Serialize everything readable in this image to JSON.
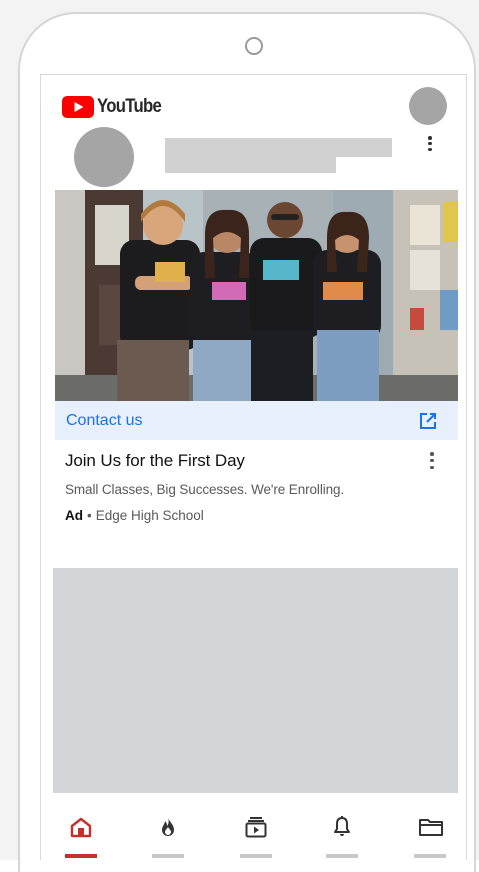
{
  "app": {
    "name": "YouTube"
  },
  "ad_card": {
    "cta_label": "Contact us",
    "title": "Join Us for the First Day",
    "description": "Small Classes, Big Successes. We're Enrolling.",
    "badge": "Ad",
    "separator": "•",
    "advertiser": "Edge High School"
  },
  "bottom_nav": [
    {
      "icon": "home-icon",
      "active": true
    },
    {
      "icon": "trending-flame-icon",
      "active": false
    },
    {
      "icon": "subscriptions-icon",
      "active": false
    },
    {
      "icon": "notifications-bell-icon",
      "active": false
    },
    {
      "icon": "library-folder-icon",
      "active": false
    }
  ],
  "colors": {
    "brand_red": "#ff0000",
    "accent_blue": "#1a73e8",
    "active_nav": "#c4302b",
    "cta_background": "#e8f0fd",
    "placeholder_gray": "#d4d5d6"
  }
}
